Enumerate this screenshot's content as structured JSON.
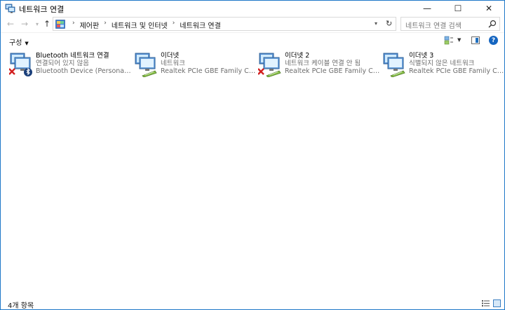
{
  "window": {
    "title": "네트워크 연결",
    "minimize": "—",
    "maximize": "☐",
    "close": "✕"
  },
  "nav": {
    "back": "←",
    "forward": "→",
    "recent": "▾",
    "up": "↑"
  },
  "address": {
    "breadcrumbs": [
      "제어판",
      "네트워크 및 인터넷",
      "네트워크 연결"
    ],
    "separator": "›",
    "dropdown": "▾",
    "refresh": "↻"
  },
  "search": {
    "placeholder": "네트워크 연결 검색"
  },
  "command_bar": {
    "organize": "구성",
    "organize_caret": "▼",
    "view_caret": "▼",
    "help": "?"
  },
  "connections": [
    {
      "name": "Bluetooth 네트워크 연결",
      "status": "연결되어 있지 않음",
      "device": "Bluetooth Device (Personal Area ...",
      "type": "bluetooth",
      "error": true
    },
    {
      "name": "이더넷",
      "status": "네트워크",
      "device": "Realtek PCIe GBE Family Controller",
      "type": "ethernet",
      "error": false
    },
    {
      "name": "이더넷 2",
      "status": "네트워크 케이블 연결 안 됨",
      "device": "Realtek PCIe GBE Family Controll...",
      "type": "ethernet",
      "error": true
    },
    {
      "name": "이더넷 3",
      "status": "식별되지 않은 네트워크",
      "device": "Realtek PCIe GBE Family Controll...",
      "type": "ethernet",
      "error": false
    }
  ],
  "status_bar": {
    "item_count": "4개 항목"
  },
  "colors": {
    "window_border": "#1e78c8",
    "help_blue": "#1565c0",
    "error_red": "#d21f1f",
    "status_gray": "#6d6d6d"
  }
}
